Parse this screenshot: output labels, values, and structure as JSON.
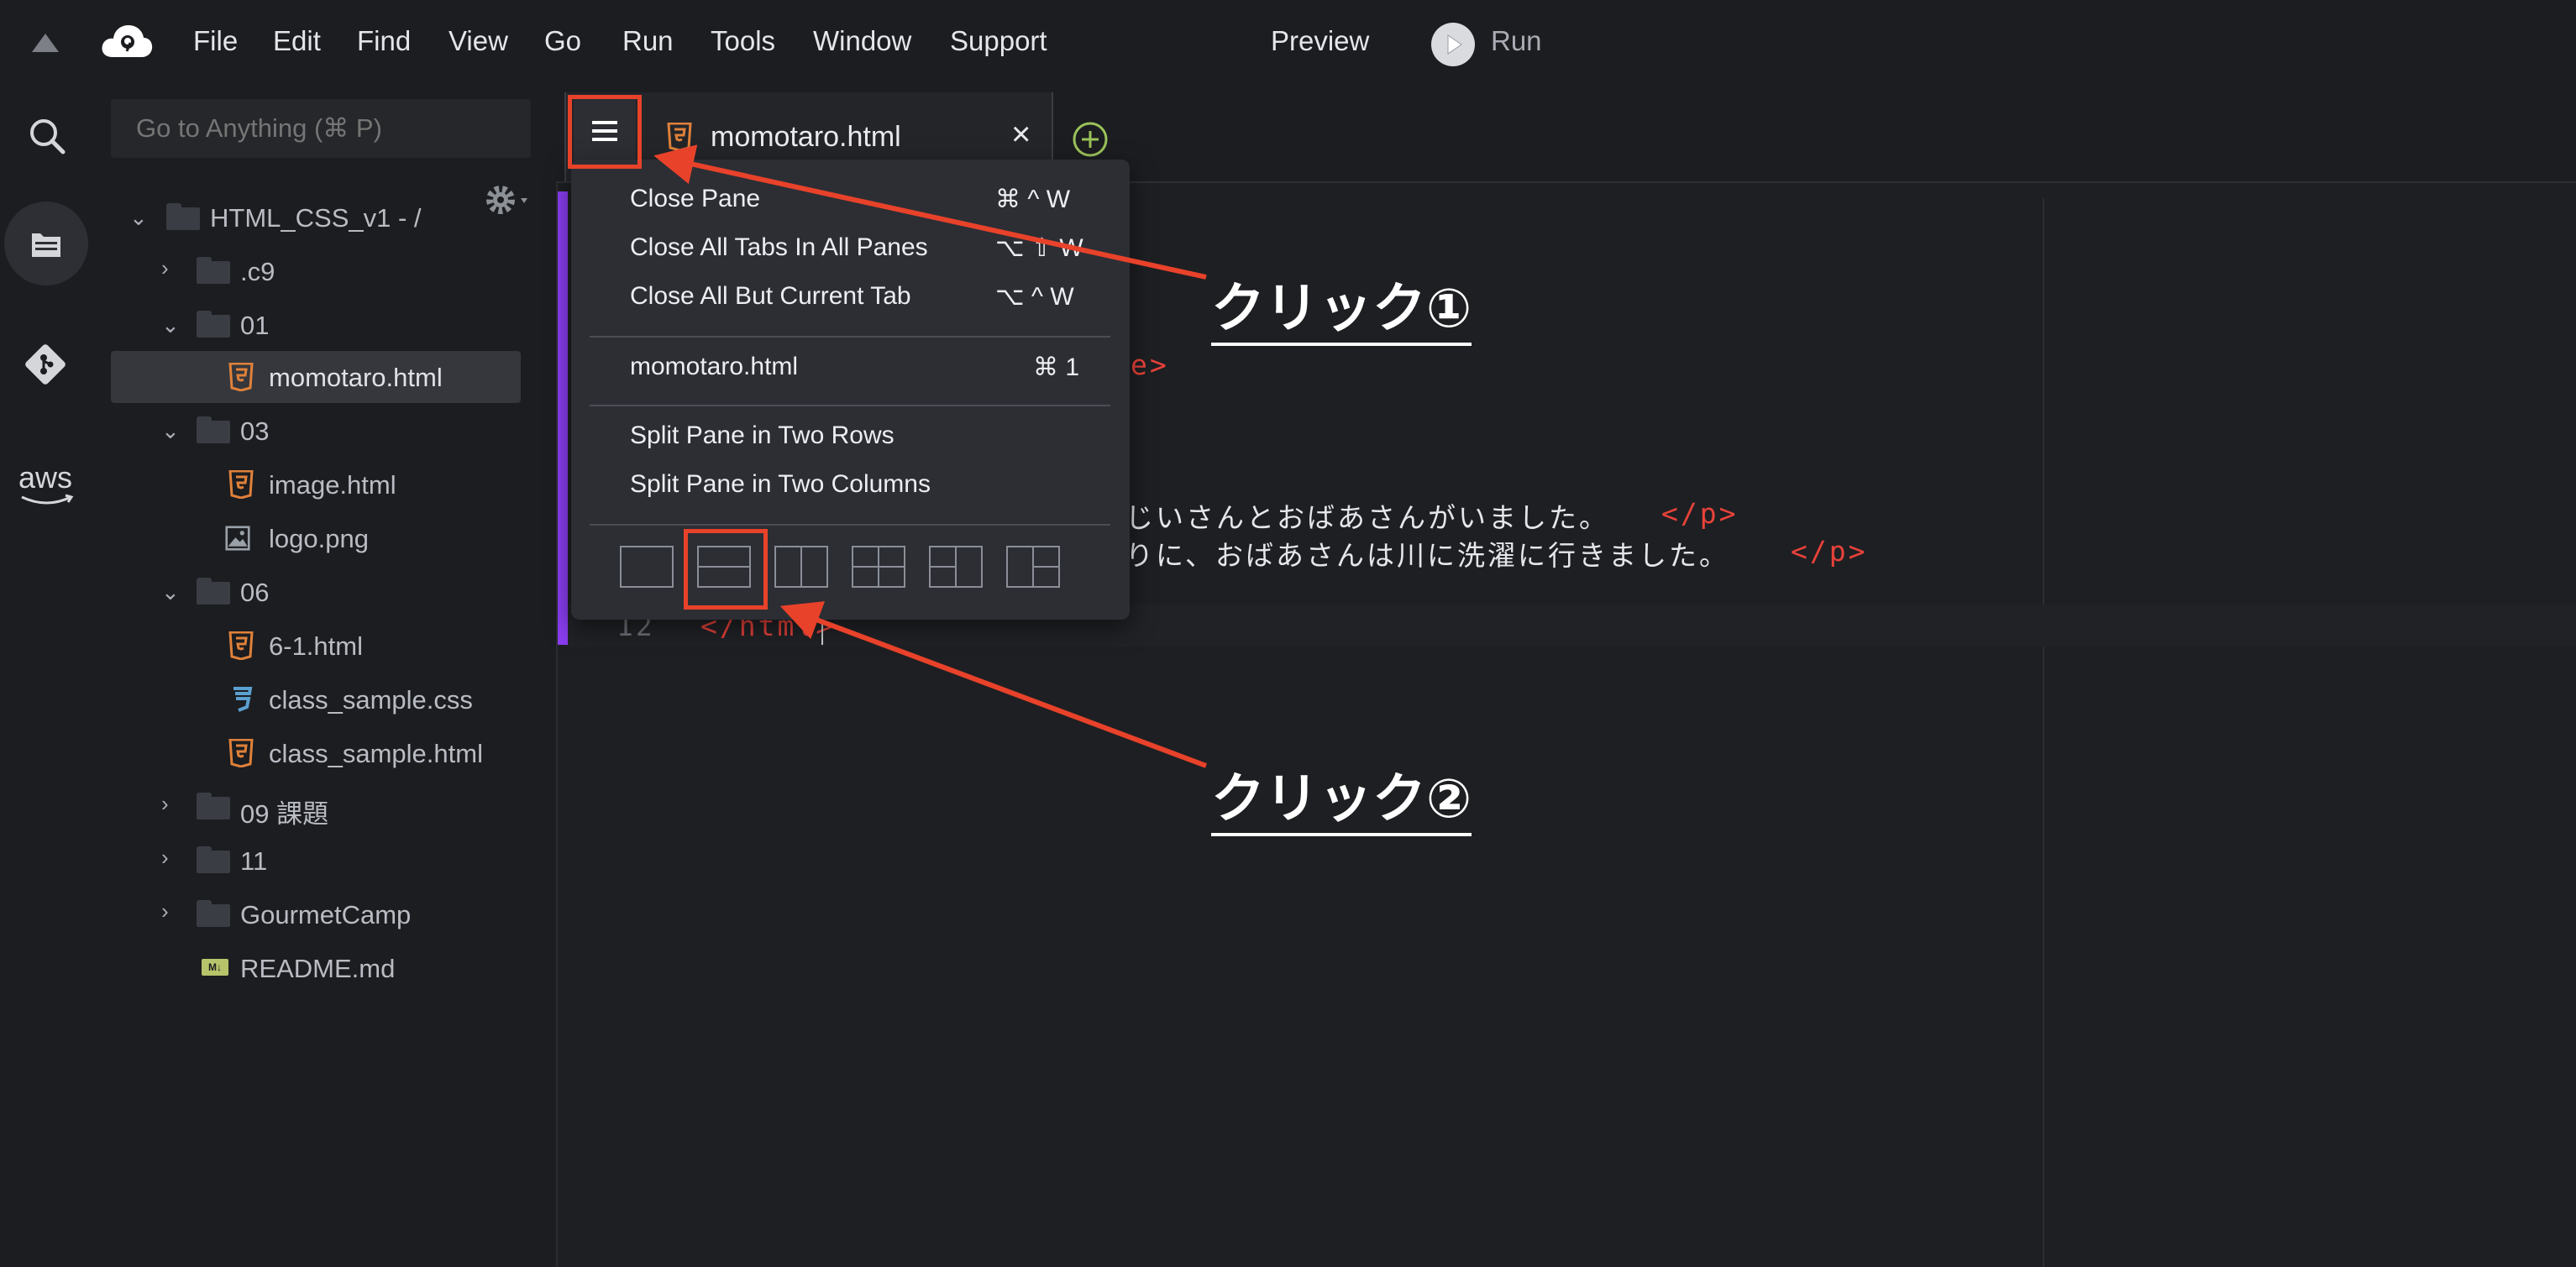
{
  "menubar": {
    "items": [
      "File",
      "Edit",
      "Find",
      "View",
      "Go",
      "Run",
      "Tools",
      "Window",
      "Support"
    ],
    "preview_label": "Preview",
    "run_label": "Run"
  },
  "sidebar": {
    "search_placeholder": "Go to Anything (⌘ P)",
    "root_label": "HTML_CSS_v1 - /",
    "items": [
      {
        "label": ".c9",
        "type": "folder",
        "state": "collapsed"
      },
      {
        "label": "01",
        "type": "folder",
        "state": "expanded"
      },
      {
        "label": "momotaro.html",
        "type": "html",
        "selected": true
      },
      {
        "label": "03",
        "type": "folder",
        "state": "expanded"
      },
      {
        "label": "image.html",
        "type": "html"
      },
      {
        "label": "logo.png",
        "type": "image"
      },
      {
        "label": "06",
        "type": "folder",
        "state": "expanded"
      },
      {
        "label": "6-1.html",
        "type": "html"
      },
      {
        "label": "class_sample.css",
        "type": "css"
      },
      {
        "label": "class_sample.html",
        "type": "html"
      },
      {
        "label": "09 課題",
        "type": "folder",
        "state": "collapsed"
      },
      {
        "label": "11",
        "type": "folder",
        "state": "collapsed"
      },
      {
        "label": "GourmetCamp",
        "type": "folder",
        "state": "collapsed"
      },
      {
        "label": "README.md",
        "type": "markdown"
      }
    ]
  },
  "editor": {
    "tab_label": "momotaro.html",
    "close_glyph": "×",
    "code_lines": [
      {
        "text": "じいさんとおばあさんがいました。",
        "tag": "</p>"
      },
      {
        "text": "りに、おばあさんは川に洗濯に行きました。",
        "tag": "</p>"
      }
    ],
    "partial_tag": "e>",
    "line_number": "12",
    "last_line": "</html>"
  },
  "dropdown": {
    "items": [
      {
        "label": "Close Pane",
        "shortcut": "⌘ ^ W"
      },
      {
        "label": "Close All Tabs In All Panes",
        "shortcut": "⌥ ⇧ W"
      },
      {
        "label": "Close All But Current Tab",
        "shortcut": "⌥ ^ W"
      },
      {
        "label": "momotaro.html",
        "shortcut": "⌘ 1"
      },
      {
        "label": "Split Pane in Two Rows",
        "shortcut": ""
      },
      {
        "label": "Split Pane in Two Columns",
        "shortcut": ""
      }
    ],
    "layout_icons": [
      "single-pane",
      "two-rows",
      "two-columns",
      "four-grid",
      "left-plus-two-right",
      "right-plus-two-left"
    ]
  },
  "annotations": {
    "click1": "クリック①",
    "click2": "クリック②"
  },
  "colors": {
    "accent_red": "#e8422a",
    "html_icon": "#e0813a",
    "css_icon": "#5aa0d0",
    "code_tag": "#e8423a",
    "editor_bar": "#8a3df0"
  }
}
